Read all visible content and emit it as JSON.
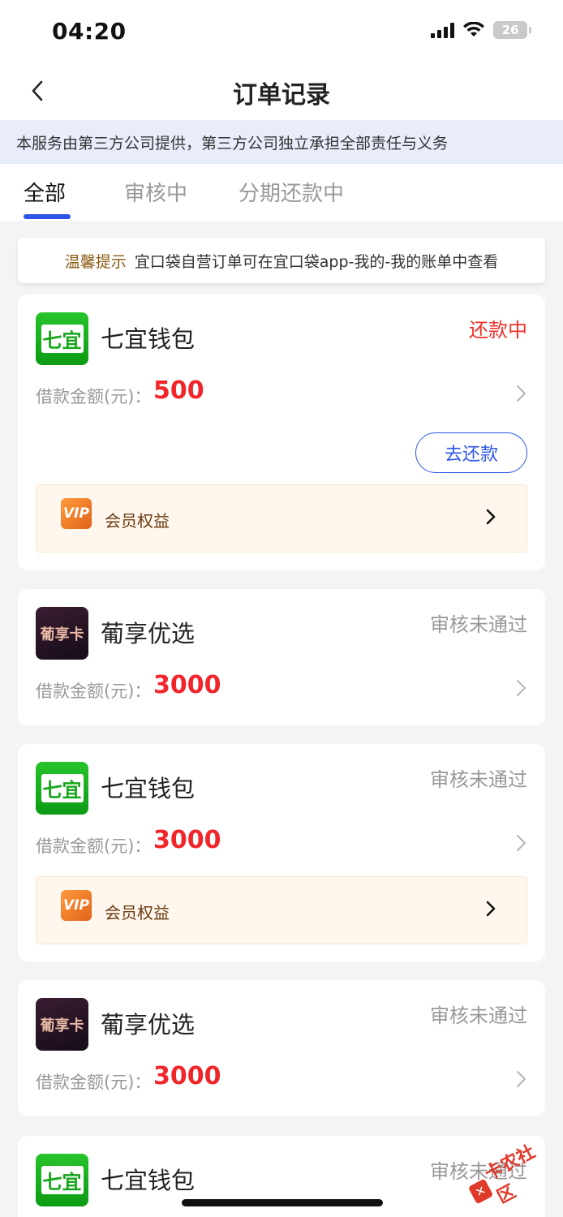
{
  "status_bar": {
    "time": "04:20",
    "battery": "26"
  },
  "nav": {
    "title": "订单记录"
  },
  "notice": "本服务由第三方公司提供，第三方公司独立承担全部责任与义务",
  "tabs": [
    {
      "label": "全部",
      "active": true
    },
    {
      "label": "审核中",
      "active": false
    },
    {
      "label": "分期还款中",
      "active": false
    }
  ],
  "tip": {
    "label": "温馨提示",
    "text": "宜口袋自营订单可在宜口袋app-我的-我的账单中查看"
  },
  "amount_label": "借款金额(元)：",
  "repay_label": "去还款",
  "vip_label": "会员权益",
  "vip_badge": "VIP",
  "orders": [
    {
      "name": "七宜钱包",
      "logo_text": "七宜",
      "status": "还款中",
      "amount": "500"
    },
    {
      "name": "葡享优选",
      "logo_text": "葡享卡",
      "status": "审核未通过",
      "amount": "3000"
    },
    {
      "name": "七宜钱包",
      "logo_text": "七宜",
      "status": "审核未通过",
      "amount": "3000"
    },
    {
      "name": "葡享优选",
      "logo_text": "葡享卡",
      "status": "审核未通过",
      "amount": "3000"
    },
    {
      "name": "七宜钱包",
      "logo_text": "七宜",
      "status": "审核未通过"
    }
  ],
  "watermark": "卡农社区",
  "colors": {
    "accent": "#2d55e8",
    "amount_red": "#f0262a",
    "status_red": "#f0312a",
    "vip_bg": "#fff7ee"
  }
}
